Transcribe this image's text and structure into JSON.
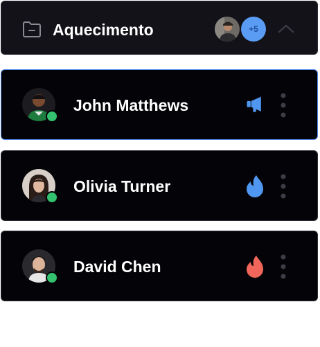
{
  "group": {
    "title": "Aquecimento",
    "extra_count": "+5"
  },
  "contacts": [
    {
      "name": "John Matthews",
      "status": "online",
      "selected": true,
      "icon": "megaphone-icon",
      "icon_color": "#4f97f0"
    },
    {
      "name": "Olivia Turner",
      "status": "online",
      "selected": false,
      "icon": "flame-icon",
      "icon_color": "#4f97f0"
    },
    {
      "name": "David Chen",
      "status": "online",
      "selected": false,
      "icon": "flame-icon",
      "icon_color": "#f0665a"
    }
  ],
  "colors": {
    "accent": "#4b86ee",
    "online": "#34c26e",
    "card_bg": "#040408",
    "header_bg": "#121218"
  }
}
